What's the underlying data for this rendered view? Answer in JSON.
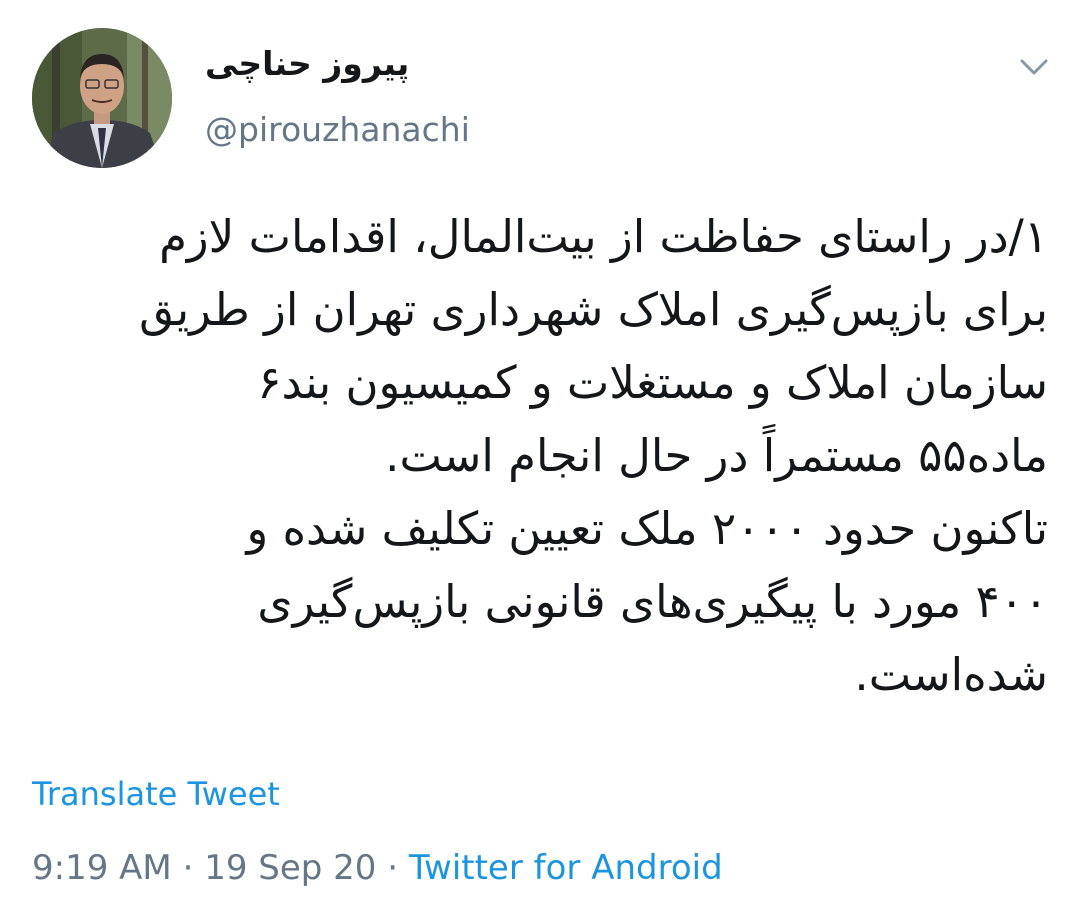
{
  "author": {
    "display_name": "پیروز حناچی",
    "handle": "@pirouzhanachi"
  },
  "header": {
    "menu_icon": "chevron-down-icon"
  },
  "tweet": {
    "lines": [
      "۱/در راستای حفاظت از بیت‌المال، اقدامات لازم",
      "برای بازپس‌گیری املاک شهرداری تهران از طریق",
      "سازمان املاک و مستغلات و کمیسیون بند۶",
      "ماده۵۵ مستمراً در حال انجام است.",
      "تاکنون حدود ۲۰۰۰ ملک تعیین تکلیف شده و",
      "۴۰۰ مورد با پیگیری‌های قانونی بازپس‌گیری",
      "شده‌است."
    ]
  },
  "translate_label": "Translate Tweet",
  "meta": {
    "time": "9:19 AM",
    "separator": "·",
    "date": "19 Sep 20",
    "source": "Twitter for Android"
  },
  "colors": {
    "link": "#1b95e0",
    "secondary": "#657786",
    "text": "#14171a"
  }
}
